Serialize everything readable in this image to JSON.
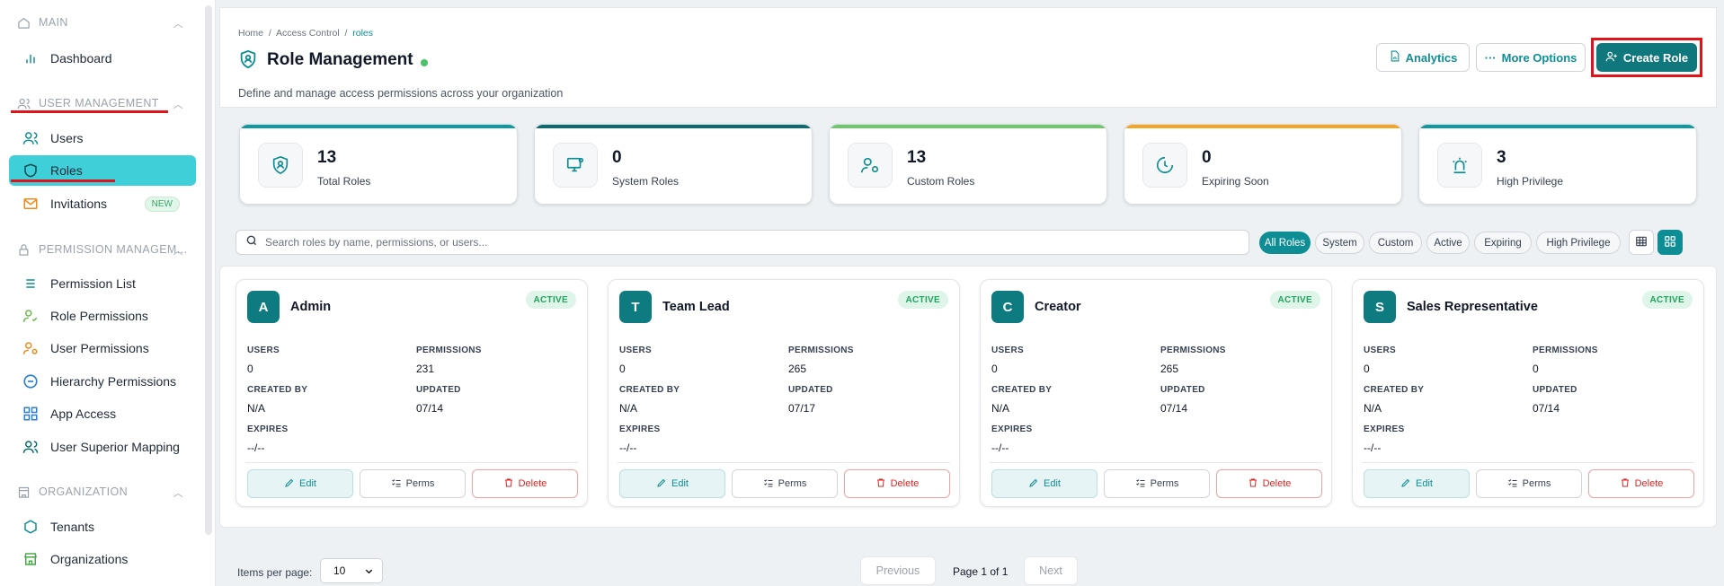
{
  "sidebar": {
    "sections": [
      {
        "label": "MAIN",
        "items": [
          {
            "label": "Dashboard"
          }
        ]
      },
      {
        "label": "USER MANAGEMENT",
        "items": [
          {
            "label": "Users"
          },
          {
            "label": "Roles"
          },
          {
            "label": "Invitations",
            "badge": "NEW"
          }
        ]
      },
      {
        "label": "PERMISSION MANAGEM...",
        "items": [
          {
            "label": "Permission List"
          },
          {
            "label": "Role Permissions"
          },
          {
            "label": "User Permissions"
          },
          {
            "label": "Hierarchy Permissions"
          },
          {
            "label": "App Access"
          },
          {
            "label": "User Superior Mapping"
          }
        ]
      },
      {
        "label": "ORGANIZATION",
        "items": [
          {
            "label": "Tenants"
          },
          {
            "label": "Organizations"
          }
        ]
      }
    ],
    "active_item": "Roles"
  },
  "header": {
    "breadcrumb": [
      "Home",
      "Access Control",
      "roles"
    ],
    "title": "Role Management",
    "subtitle": "Define and manage access permissions across your organization",
    "buttons": {
      "analytics": "Analytics",
      "more": "More Options",
      "create": "Create Role"
    }
  },
  "stats": [
    {
      "value": "13",
      "label": "Total Roles",
      "color": "#0e9aa0",
      "icon": "shield-user-icon"
    },
    {
      "value": "0",
      "label": "System Roles",
      "color": "#0b6b6f",
      "icon": "monitor-settings-icon"
    },
    {
      "value": "13",
      "label": "Custom Roles",
      "color": "#6cc86a",
      "icon": "user-gear-icon"
    },
    {
      "value": "0",
      "label": "Expiring Soon",
      "color": "#f5a524",
      "icon": "clock-icon"
    },
    {
      "value": "3",
      "label": "High Privilege",
      "color": "#0e9aa0",
      "icon": "siren-icon"
    }
  ],
  "search": {
    "placeholder": "Search roles by name, permissions, or users..."
  },
  "filters": [
    "All Roles",
    "System",
    "Custom",
    "Active",
    "Expiring",
    "High Privilege"
  ],
  "active_filter": "All Roles",
  "field_labels": {
    "users": "USERS",
    "permissions": "PERMISSIONS",
    "created_by": "CREATED BY",
    "updated": "UPDATED",
    "expires": "EXPIRES"
  },
  "card_actions": {
    "edit": "Edit",
    "perms": "Perms",
    "delete": "Delete"
  },
  "roles": [
    {
      "initial": "A",
      "name": "Admin",
      "status": "ACTIVE",
      "users": "0",
      "permissions": "231",
      "created_by": "N/A",
      "updated": "07/14",
      "expires": "--/--"
    },
    {
      "initial": "T",
      "name": "Team Lead",
      "status": "ACTIVE",
      "users": "0",
      "permissions": "265",
      "created_by": "N/A",
      "updated": "07/17",
      "expires": "--/--"
    },
    {
      "initial": "C",
      "name": "Creator",
      "status": "ACTIVE",
      "users": "0",
      "permissions": "265",
      "created_by": "N/A",
      "updated": "07/14",
      "expires": "--/--"
    },
    {
      "initial": "S",
      "name": "Sales Representative",
      "status": "ACTIVE",
      "users": "0",
      "permissions": "0",
      "created_by": "N/A",
      "updated": "07/14",
      "expires": "--/--"
    }
  ],
  "pagination": {
    "items_per_page_label": "Items per page:",
    "items_per_page": "10",
    "previous": "Previous",
    "page_info": "Page 1 of 1",
    "next": "Next"
  }
}
